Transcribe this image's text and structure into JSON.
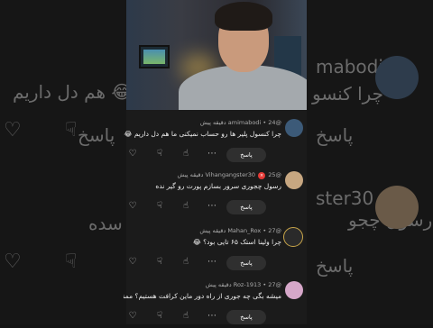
{
  "background": {
    "ghost_texts": [
      "😂😂 هم دل داریم",
      "چرا کنسو",
      "رسول چجو",
      "سده",
      "ster30",
      "mabodi"
    ],
    "ghost_reply": [
      "پاسخ",
      "پاسخ",
      "پاسخ"
    ]
  },
  "comments": [
    {
      "author": "@amimabodi",
      "time": "24 دقیقه پیش",
      "text": "چرا کنسول پلیر ها رو حساب نمیکنی ما هم دل داریم 😂😂",
      "reply_label": "پاسخ",
      "avatar_color": "#3c5a78",
      "badge": ""
    },
    {
      "author": "@Vihangangster30",
      "time": "25 دقیقه پیش",
      "text": "رسول چجوری سرور بسازم پورت رو گیر نده",
      "reply_label": "پاسخ",
      "avatar_color": "#c7a781",
      "badge": "🅧"
    },
    {
      "author": "@Mahan_Rox",
      "time": "27 دقیقه پیش",
      "text": "چرا ولینا استک ۶۵ تایی بود؟ 😂",
      "reply_label": "پاسخ",
      "avatar_color": "#2a2a2a",
      "badge": ""
    },
    {
      "author": "@Roz-1913",
      "time": "27 دقیقه پیش",
      "text": "میشه بگی چه جوری از راه دور ماین کرافت هستیم؟ ممنون کرافت",
      "reply_label": "پاسخ",
      "avatar_color": "#d6a7c9",
      "badge": ""
    }
  ],
  "icons": {
    "like": "like-icon",
    "dislike": "dislike-icon",
    "heart": "heart-icon"
  }
}
